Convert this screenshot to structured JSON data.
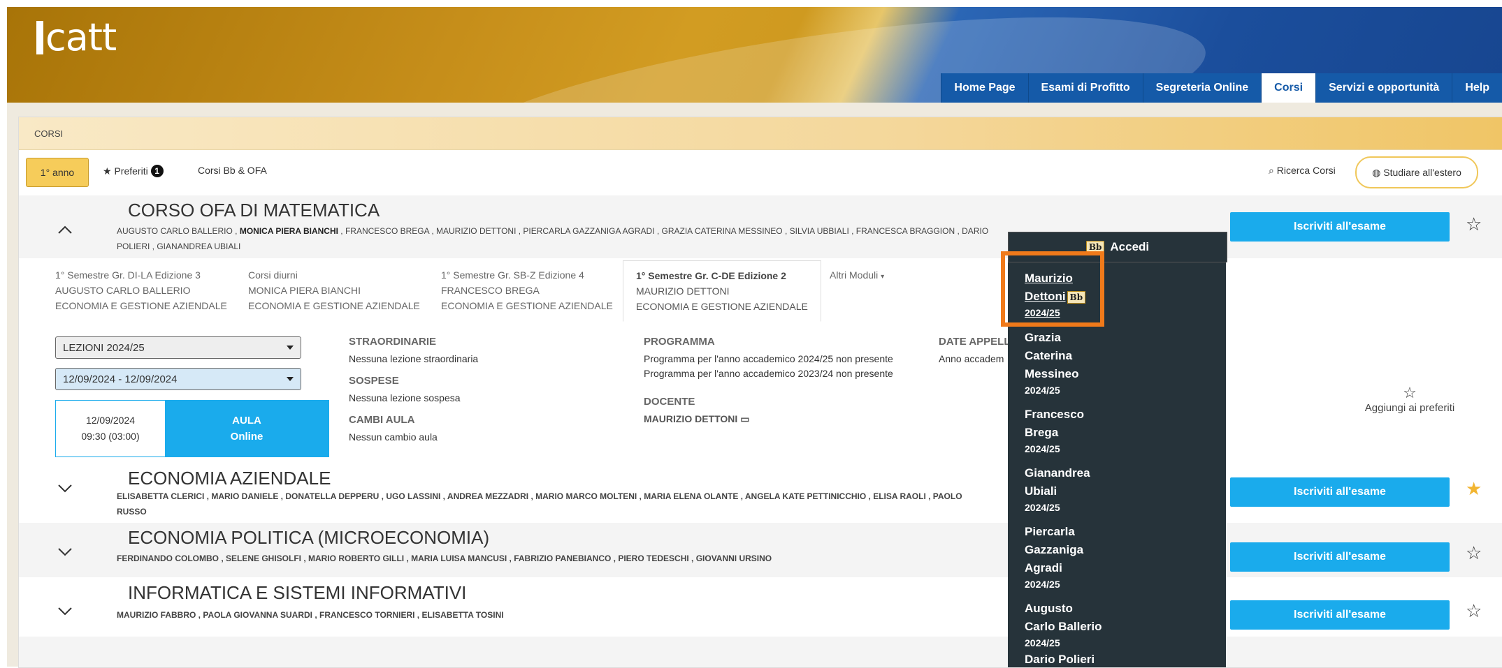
{
  "header": {
    "logo_text": "catt"
  },
  "nav": {
    "tabs": [
      "Home Page",
      "Esami di Profitto",
      "Segreteria Online",
      "Corsi",
      "Servizi e opportunità",
      "Help"
    ],
    "active": "Corsi"
  },
  "breadcrumb": "CORSI",
  "toolbar": {
    "year_button": "1° anno",
    "preferiti": "Preferiti",
    "preferiti_count": "1",
    "corsi_bb": "Corsi Bb & OFA",
    "ricerca": "Ricerca Corsi",
    "estero": "Studiare all'estero"
  },
  "courses": [
    {
      "title": "CORSO OFA DI MATEMATICA",
      "teachers_line1": "AUGUSTO CARLO BALLERIO , MONICA PIERA BIANCHI , FRANCESCO BREGA , MAURIZIO DETTONI , PIERCARLA GAZZANIGA AGRADI , GRAZIA CATERINA MESSINEO , SILVIA UBBIALI , FRANCESCA BRAGGION , DARIO",
      "teachers_line2": "POLIERI , GIANANDREA UBIALI",
      "expanded": true
    },
    {
      "title": "ECONOMIA AZIENDALE",
      "teachers_line1": "ELISABETTA CLERICI , MARIO DANIELE , DONATELLA DEPPERU , UGO LASSINI , ANDREA MEZZADRI , MARIO MARCO MOLTENI , MARIA ELENA OLANTE , ANGELA KATE PETTINICCHIO , ELISA RAOLI , PAOLO",
      "teachers_line2": "RUSSO",
      "favorite": true
    },
    {
      "title": "ECONOMIA POLITICA (MICROECONOMIA)",
      "teachers_line1": "FERDINANDO COLOMBO , SELENE GHISOLFI , MARIO ROBERTO GILLI , MARIA LUISA MANCUSI , FABRIZIO PANEBIANCO , PIERO TEDESCHI , GIOVANNI URSINO"
    },
    {
      "title": "INFORMATICA E SISTEMI INFORMATIVI",
      "teachers_line1": "MAURIZIO FABBRO , PAOLA GIOVANNA SUARDI , FRANCESCO TORNIERI , ELISABETTA TOSINI"
    }
  ],
  "accedi_label": "Accedi",
  "iscriviti_label": "Iscriviti all'esame",
  "detail_tabs": [
    {
      "l1": "1° Semestre Gr. DI-LA Edizione 3",
      "l2": "AUGUSTO CARLO BALLERIO",
      "l3": "ECONOMIA E GESTIONE AZIENDALE"
    },
    {
      "l1": "Corsi diurni",
      "l2": "MONICA PIERA BIANCHI",
      "l3": "ECONOMIA E GESTIONE AZIENDALE"
    },
    {
      "l1": "1° Semestre Gr. SB-Z Edizione 4",
      "l2": "FRANCESCO BREGA",
      "l3": "ECONOMIA E GESTIONE AZIENDALE"
    },
    {
      "l1": "1° Semestre Gr. C-DE Edizione 2",
      "l2": "MAURIZIO DETTONI",
      "l3": "ECONOMIA E GESTIONE AZIENDALE"
    }
  ],
  "altri_moduli": "Altri Moduli",
  "lezioni_select": "LEZIONI 2024/25",
  "date_select": "12/09/2024 - 12/09/2024",
  "lesson": {
    "date": "12/09/2024",
    "time": "09:30 (03:00)",
    "aula": "AULA",
    "room": "Online"
  },
  "sections": {
    "straordinarie": {
      "h": "STRAORDINARIE",
      "v": "Nessuna lezione straordinaria"
    },
    "sospese": {
      "h": "SOSPESE",
      "v": "Nessuna lezione sospesa"
    },
    "cambi": {
      "h": "CAMBI AULA",
      "v": "Nessun cambio aula"
    },
    "programma": {
      "h": "PROGRAMMA",
      "v1": "Programma per l'anno accademico 2024/25 non presente",
      "v2": "Programma per l'anno accademico 2023/24 non presente"
    },
    "docente": {
      "h": "DOCENTE",
      "v": "MAURIZIO DETTONI"
    },
    "date_appelli": {
      "h": "DATE APPELL",
      "v": "Anno accadem"
    }
  },
  "aggiungi_preferiti": "Aggiungi ai preferiti",
  "dropdown": [
    {
      "l1": "Maurizio",
      "l2": "Dettoni",
      "yr": "2024/25"
    },
    {
      "l1": "Grazia",
      "l2": "Caterina",
      "l3": "Messineo",
      "yr": "2024/25"
    },
    {
      "l1": "Francesco",
      "l2": "Brega",
      "yr": "2024/25"
    },
    {
      "l1": "Gianandrea",
      "l2": "Ubiali",
      "yr": "2024/25"
    },
    {
      "l1": "Piercarla",
      "l2": "Gazzaniga",
      "l3": "Agradi",
      "yr": "2024/25"
    },
    {
      "l1": "Augusto",
      "l2": "Carlo Ballerio",
      "yr": "2024/25"
    },
    {
      "l1": "Dario Polieri"
    }
  ],
  "colors": {
    "accent_blue": "#1aabec",
    "nav_blue": "#155aa8",
    "gold": "#f6cc5a",
    "dark": "#26333a",
    "highlight": "#f07a1a"
  }
}
